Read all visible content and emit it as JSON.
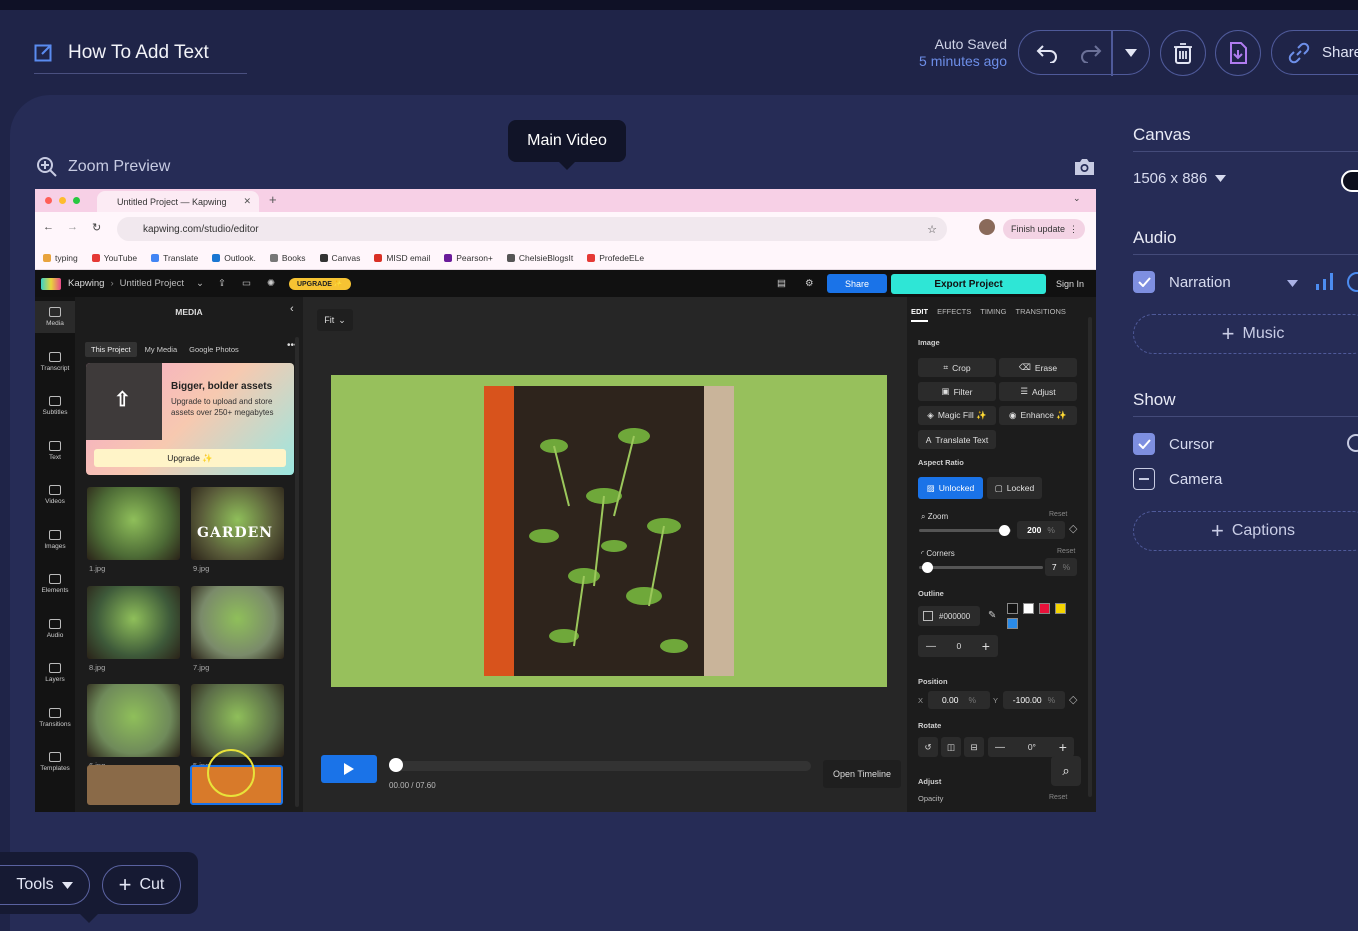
{
  "header": {
    "title": "How To Add Text",
    "autosave_line1": "Auto Saved",
    "autosave_line2": "5 minutes ago",
    "share_label": "Share"
  },
  "preview": {
    "zoom_label": "Zoom Preview",
    "tooltip": "Main Video"
  },
  "sidebar": {
    "canvas_title": "Canvas",
    "canvas_size": "1506 x 886",
    "audio_title": "Audio",
    "narration_label": "Narration",
    "music_label": "Music",
    "show_title": "Show",
    "cursor_label": "Cursor",
    "camera_label": "Camera",
    "captions_label": "Captions"
  },
  "tools": {
    "tools_label": "Tools",
    "cut_label": "Cut"
  },
  "browser": {
    "tab_title": "Untitled Project — Kapwing",
    "url": "kapwing.com/studio/editor",
    "finish_update": "Finish update",
    "bookmarks": [
      "typing",
      "YouTube",
      "Translate",
      "Outlook.",
      "Books",
      "Canvas",
      "MISD email",
      "Pearson+",
      "ChelsieBlogsIt",
      "ProfedeELe"
    ],
    "bookmark_colors": [
      "#e8a33d",
      "#e53935",
      "#4285f4",
      "#1976d2",
      "#777777",
      "#333333",
      "#d93025",
      "#6a1b9a",
      "#555555",
      "#e53935"
    ]
  },
  "kapwing": {
    "brand": "Kapwing",
    "project": "Untitled Project",
    "upgrade_badge": "UPGRADE ✨",
    "share": "Share",
    "export": "Export Project",
    "signin": "Sign In",
    "left_nav": [
      "Media",
      "Transcript",
      "Subtitles",
      "Text",
      "Videos",
      "Images",
      "Elements",
      "Audio",
      "Layers",
      "Transitions",
      "Templates"
    ],
    "media_title": "MEDIA",
    "media_tabs": [
      "This Project",
      "My Media",
      "Google Photos"
    ],
    "promo_title": "Bigger, bolder assets",
    "promo_body": "Upgrade to upload and store assets over 250+ megabytes",
    "promo_button": "Upgrade ✨",
    "thumbs": [
      "1.jpg",
      "9.jpg",
      "8.jpg",
      "7.jpg",
      "6.jpg",
      "5.jpg"
    ],
    "garden_text": "GARDEN",
    "fit": "Fit",
    "time": "00.00 / 07.60",
    "open_timeline": "Open Timeline",
    "panel_tabs": [
      "EDIT",
      "EFFECTS",
      "TIMING",
      "TRANSITIONS"
    ],
    "image_label": "Image",
    "buttons": [
      "Crop",
      "Erase",
      "Filter",
      "Adjust",
      "Magic Fill ✨",
      "Enhance ✨",
      "Translate Text"
    ],
    "aspect_ratio": "Aspect Ratio",
    "unlocked": "Unlocked",
    "locked": "Locked",
    "zoom": "Zoom",
    "reset": "Reset",
    "zoom_value": "200",
    "zoom_unit": "%",
    "corners": "Corners",
    "corners_value": "7",
    "outline": "Outline",
    "outline_color": "#000000",
    "outline_width": "0",
    "position": "Position",
    "pos_x_label": "X",
    "pos_x": "0.00",
    "pos_y_label": "Y",
    "pos_y": "-100.00",
    "rotate": "Rotate",
    "rotate_value": "0°",
    "adjust": "Adjust",
    "opacity": "Opacity",
    "zoom_slider_level": 0.93,
    "corners_slider_level": 0.07,
    "swatches": [
      "#111111",
      "#ffffff",
      "#e8123a",
      "#f5d400",
      "#2a8be8"
    ]
  },
  "colors": {
    "accent": "#7e8fe0",
    "link": "#6d8ee8",
    "export": "#2ee6d6",
    "kapwing_blue": "#1a73e8",
    "canvas_bg": "#97c05c"
  }
}
